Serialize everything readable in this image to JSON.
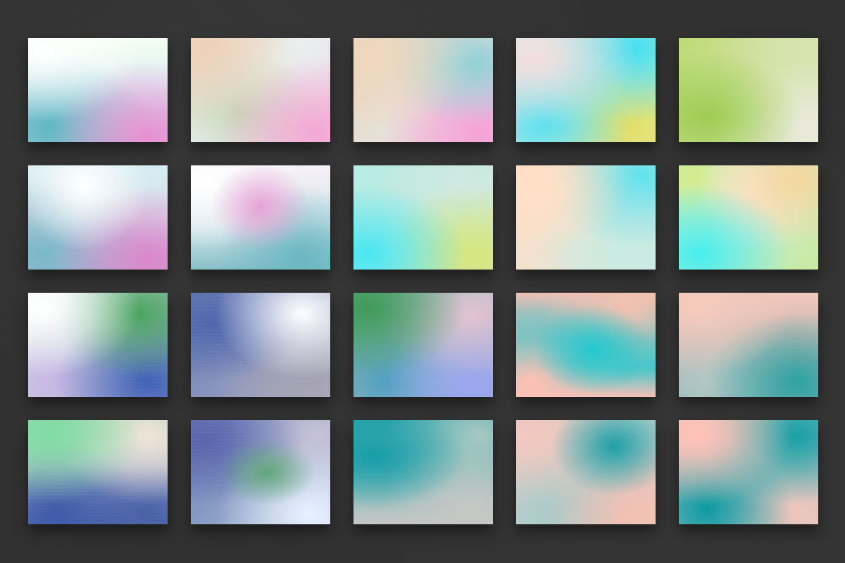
{
  "canvas": {
    "background_color": "#303030"
  },
  "swatches": [
    {
      "id": 1,
      "palette": [
        "#ffffff",
        "#5fb7c4",
        "#e98fd0"
      ]
    },
    {
      "id": 2,
      "palette": [
        "#efd1b9",
        "#c7d7b7",
        "#f3a7d3"
      ]
    },
    {
      "id": 3,
      "palette": [
        "#efd7bd",
        "#8fd0d8",
        "#f6a2d8"
      ]
    },
    {
      "id": 4,
      "palette": [
        "#f2dde0",
        "#46dff1",
        "#e1df66"
      ]
    },
    {
      "id": 5,
      "palette": [
        "#9dcc52",
        "#d8e3b1",
        "#eaeadb"
      ]
    },
    {
      "id": 6,
      "palette": [
        "#ffffff",
        "#79b8c8",
        "#db86cb"
      ]
    },
    {
      "id": 7,
      "palette": [
        "#ffffff",
        "#e7a2d6",
        "#6ab7c1"
      ]
    },
    {
      "id": 8,
      "palette": [
        "#49e7f3",
        "#d1e9e2",
        "#d6e67c"
      ]
    },
    {
      "id": 9,
      "palette": [
        "#ffe1c7",
        "#5ee3f0",
        "#c9ebe2"
      ]
    },
    {
      "id": 10,
      "palette": [
        "#45eeef",
        "#ffe7dc",
        "#f5d79d"
      ]
    },
    {
      "id": 11,
      "palette": [
        "#ffffff",
        "#4aa35f",
        "#4162b7"
      ]
    },
    {
      "id": 12,
      "palette": [
        "#4f67ad",
        "#ffffff",
        "#a5a3b3"
      ]
    },
    {
      "id": 13,
      "palette": [
        "#3f9a5a",
        "#e2c2d2",
        "#9ba7ee"
      ]
    },
    {
      "id": 14,
      "palette": [
        "#f0bfb5",
        "#22c9cf",
        "#ffc1b5"
      ]
    },
    {
      "id": 15,
      "palette": [
        "#f5cbbd",
        "#b5c9c6",
        "#2ea2a2"
      ]
    },
    {
      "id": 16,
      "palette": [
        "#7fdca0",
        "#f0e3d7",
        "#3e5aa9"
      ]
    },
    {
      "id": 17,
      "palette": [
        "#5a66ad",
        "#62a77b",
        "#e8f1ff"
      ]
    },
    {
      "id": 18,
      "palette": [
        "#169da9",
        "#a8c8c3",
        "#c7c8c5"
      ]
    },
    {
      "id": 19,
      "palette": [
        "#f4c8bf",
        "#1ea0a6",
        "#f4c0b3"
      ]
    },
    {
      "id": 20,
      "palette": [
        "#ffc2b8",
        "#1aa0a6",
        "#0f9aa3"
      ]
    }
  ]
}
